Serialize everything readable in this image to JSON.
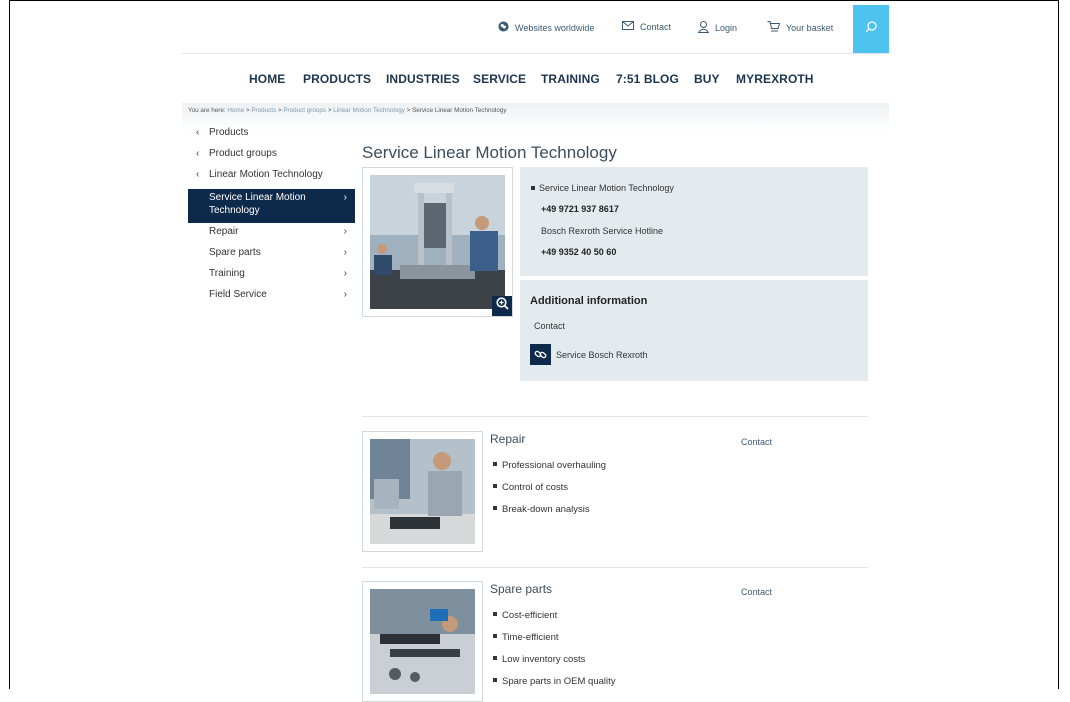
{
  "topbar": {
    "worldwide": "Websites worldwide",
    "contact": "Contact",
    "login": "Login",
    "basket": "Your basket"
  },
  "nav": [
    "HOME",
    "PRODUCTS",
    "INDUSTRIES",
    "SERVICE",
    "TRAINING",
    "7:51 BLOG",
    "BUY",
    "MYREXROTH"
  ],
  "breadcrumb": {
    "prefix": "You are here:",
    "links": [
      "Home",
      "Products",
      "Product groups",
      "Linear Motion Technology"
    ],
    "current": "Service Linear Motion Technology"
  },
  "sidebar": {
    "back": [
      "Products",
      "Product groups",
      "Linear Motion Technology"
    ],
    "active": "Service Linear Motion Technology",
    "sub": [
      "Repair",
      "Spare parts",
      "Training",
      "Field Service"
    ]
  },
  "page": {
    "title": "Service Linear Motion Technology"
  },
  "info": {
    "heading": "Service Linear Motion Technology",
    "phone1": "+49 9721 937 8617",
    "hotline": "Bosch Rexroth Service Hotline",
    "phone2": "+49 9352 40 50 60",
    "additional_title": "Additional information",
    "contact": "Contact",
    "link": "Service Bosch Rexroth"
  },
  "cards": [
    {
      "title": "Repair",
      "contact": "Contact",
      "bullets": [
        "Professional overhauling",
        "Control of costs",
        "Break-down analysis"
      ]
    },
    {
      "title": "Spare parts",
      "contact": "Contact",
      "bullets": [
        "Cost-efficient",
        "Time-efficient",
        "Low inventory costs",
        "Spare parts in OEM quality"
      ]
    }
  ],
  "colors": {
    "navy": "#0e2a4a",
    "accent": "#4fc3f0",
    "panel": "#e4ebee"
  },
  "icons": [
    "globe-icon",
    "mail-icon",
    "user-icon",
    "cart-icon",
    "search-icon",
    "zoom-icon",
    "link-icon",
    "chevron-left-icon",
    "chevron-right-icon"
  ]
}
